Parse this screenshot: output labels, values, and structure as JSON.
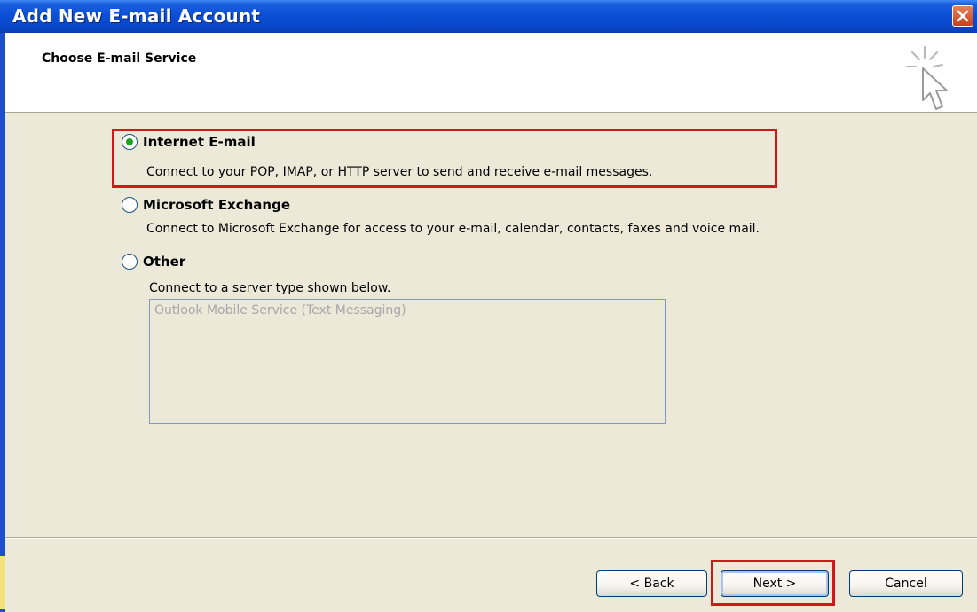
{
  "window": {
    "title": "Add New E-mail Account",
    "close_icon": "close-icon"
  },
  "header": {
    "title": "Choose E-mail Service",
    "icon": "wizard-cursor-icon"
  },
  "options": [
    {
      "label": "Internet E-mail",
      "description": "Connect to your POP, IMAP, or HTTP server to send and receive e-mail messages.",
      "selected": true
    },
    {
      "label": "Microsoft Exchange",
      "description": "Connect to Microsoft Exchange for access to your e-mail, calendar, contacts, faxes and voice mail.",
      "selected": false
    },
    {
      "label": "Other",
      "description": "Connect to a server type shown below.",
      "selected": false
    }
  ],
  "server_list": {
    "items": [
      "Outlook Mobile Service (Text Messaging)"
    ],
    "enabled": false
  },
  "buttons": {
    "back": "< Back",
    "next": "Next >",
    "cancel": "Cancel"
  },
  "colors": {
    "title_bar": "#0a4fd6",
    "highlight": "#d01818",
    "radio_dot": "#21a121"
  }
}
